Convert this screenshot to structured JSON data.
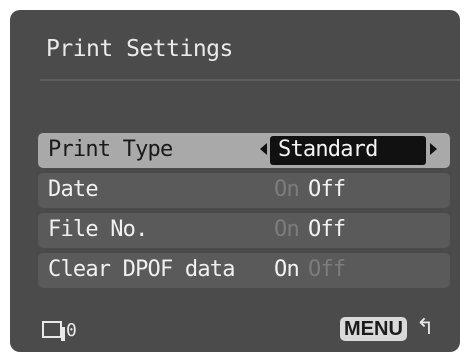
{
  "title": "Print Settings",
  "rows": [
    {
      "label": "Print Type",
      "value": "Standard"
    },
    {
      "label": "Date",
      "on": "On",
      "off": "Off",
      "selected": "Off"
    },
    {
      "label": "File No.",
      "on": "On",
      "off": "Off",
      "selected": "Off"
    },
    {
      "label": "Clear DPOF data",
      "on": "On",
      "off": "Off",
      "selected": "On"
    }
  ],
  "footer": {
    "copies_count": "0",
    "menu_label": "MENU",
    "back_glyph": "↰"
  }
}
